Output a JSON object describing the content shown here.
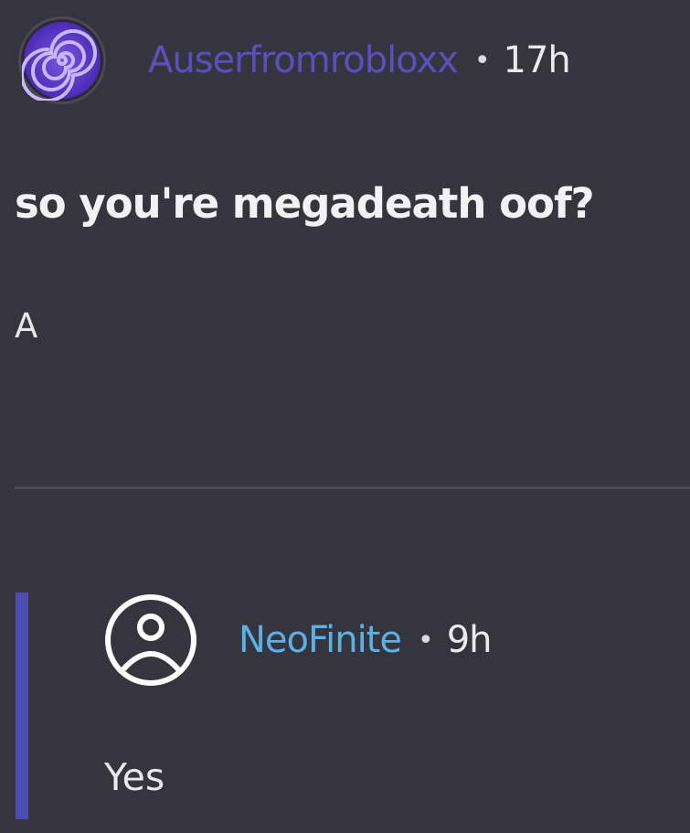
{
  "post": {
    "author": "Auserfromrobloxx",
    "separator": "•",
    "time": "17h",
    "title": "so you're megadeath oof?",
    "body": "A",
    "avatar_icon": "spiral-avatar-icon",
    "author_color": "#5b4fbf"
  },
  "reply": {
    "author": "NeoFinite",
    "separator": "•",
    "time": "9h",
    "body": "Yes",
    "avatar_icon": "default-user-icon",
    "author_color": "#59b1e6",
    "thread_bar_color": "#4c4cb3"
  }
}
